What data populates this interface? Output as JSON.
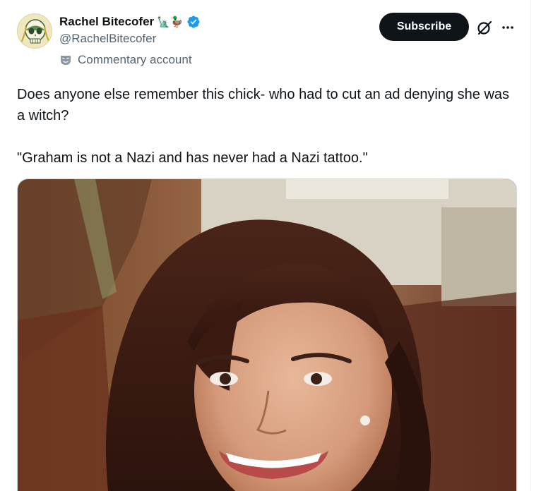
{
  "author": {
    "display_name": "Rachel Bitecofer",
    "name_emojis": "🗽🦆",
    "handle": "@RachelBitecofer",
    "label": "Commentary account"
  },
  "actions": {
    "subscribe_label": "Subscribe"
  },
  "post": {
    "text_line1": "Does anyone else remember this chick- who had to cut an ad denying she was a witch?",
    "text_line2": "\"Graham is not a Nazi and has never had a Nazi tattoo.\""
  },
  "colors": {
    "verified": "#1d9bf0",
    "subscribe_bg": "#0f1419",
    "secondary_text": "#536471"
  },
  "icons": [
    "verified-badge-icon",
    "commentary-mask-icon",
    "grok-icon",
    "more-options-icon"
  ]
}
